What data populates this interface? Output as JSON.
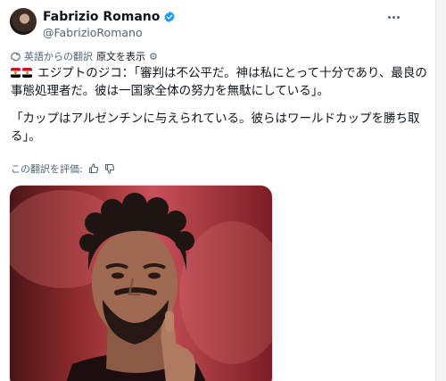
{
  "author": {
    "display_name": "Fabrizio Romano",
    "handle": "@FabrizioRomano"
  },
  "translation": {
    "note": "英語からの翻訳",
    "show_original": "原文を表示"
  },
  "tweet": {
    "para1": "エジプトのジコ：「審判は不公平だ。神は私にとって十分であり、最良の事態処理者だ。彼は一国家全体の努力を無駄にしている」。",
    "para2": "「カップはアルゼンチンに与えられている。彼らはワールドカップを勝ち取る」。"
  },
  "rating": {
    "label": "この翻訳を評価:"
  },
  "icons": {
    "more": "more-icon",
    "verified": "verified-badge-icon",
    "translate": "translate-icon",
    "settings": "gear-icon",
    "thumb_up": "thumb-up-icon",
    "thumb_down": "thumb-down-icon",
    "flag": "egypt-flag-icon"
  },
  "colors": {
    "verified_blue": "#1d9bf0",
    "secondary_text": "#536471",
    "primary_text": "#0f1419"
  }
}
